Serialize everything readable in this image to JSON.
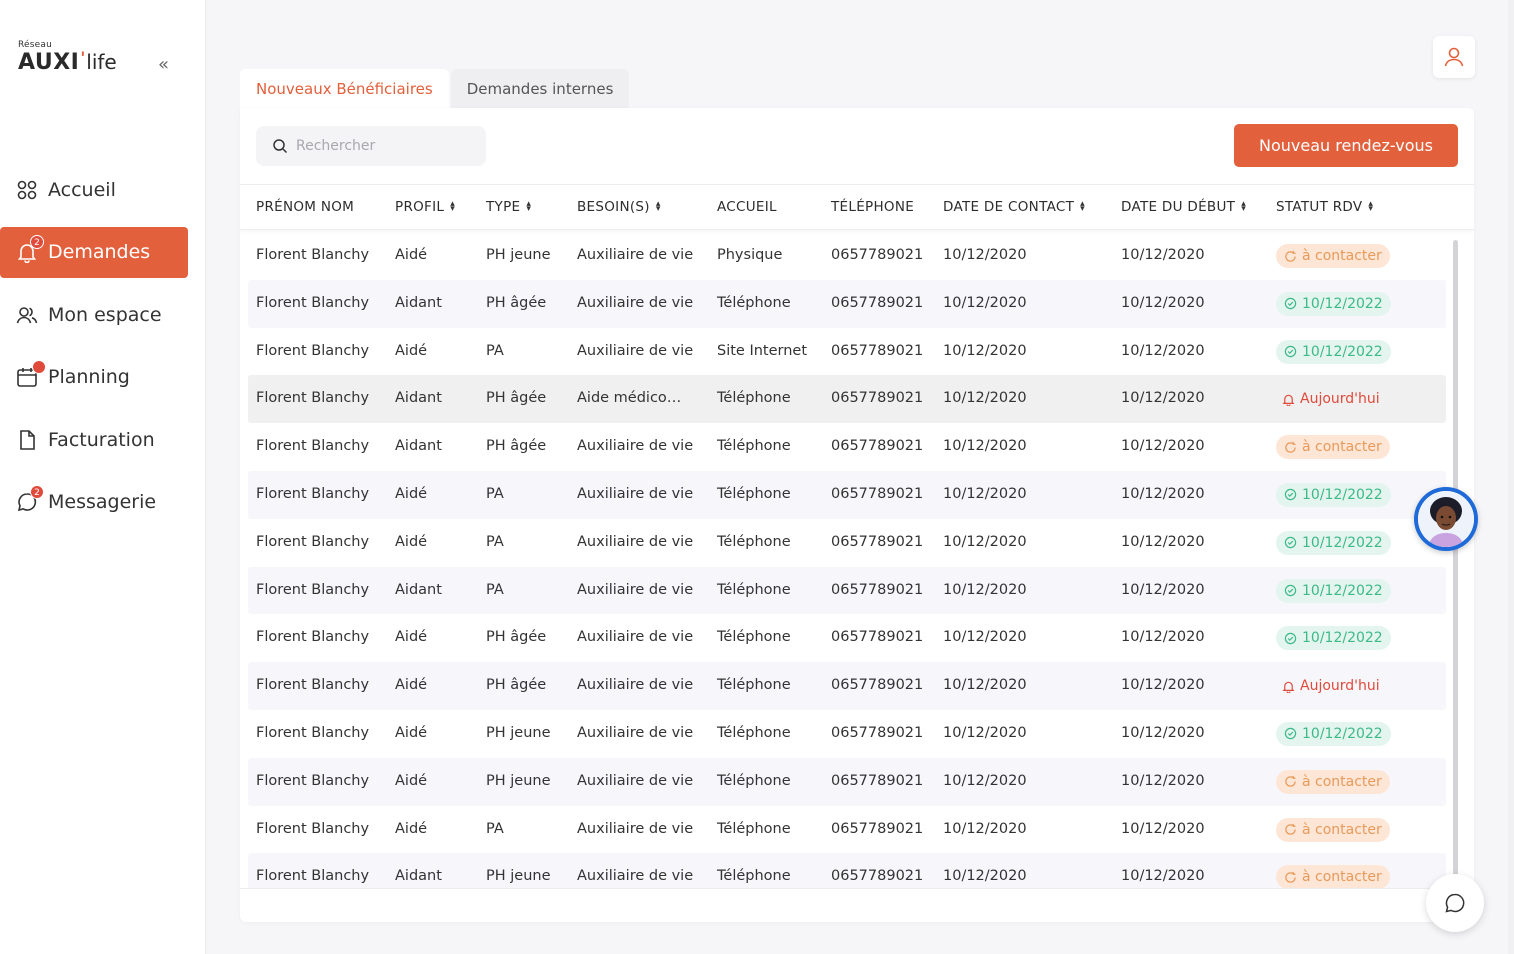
{
  "brand": {
    "small": "Réseau",
    "main": "AUXI",
    "tick": "'",
    "suffix": "life"
  },
  "colors": {
    "accent": "#e2603c",
    "contact": "#e89a5a",
    "date": "#3eb98a",
    "today": "#e04a3a"
  },
  "sidebar": {
    "items": [
      {
        "label": "Accueil",
        "icon": "grid-icon",
        "badge": ""
      },
      {
        "label": "Demandes",
        "icon": "bell-icon",
        "badge": "2",
        "active": true
      },
      {
        "label": "Mon espace",
        "icon": "users-icon",
        "badge": ""
      },
      {
        "label": "Planning",
        "icon": "calendar-icon",
        "badge": "dot"
      },
      {
        "label": "Facturation",
        "icon": "file-icon",
        "badge": ""
      },
      {
        "label": "Messagerie",
        "icon": "chat-icon",
        "badge": "2"
      }
    ]
  },
  "tabs": [
    {
      "label": "Nouveaux Bénéficiaires",
      "active": true
    },
    {
      "label": "Demandes internes",
      "active": false
    }
  ],
  "search": {
    "placeholder": "Rechercher",
    "value": ""
  },
  "new_button": {
    "label": "Nouveau rendez-vous"
  },
  "table": {
    "columns": [
      {
        "label": "PRÉNOM NOM",
        "sortable": false
      },
      {
        "label": "PROFIL",
        "sortable": true
      },
      {
        "label": "TYPE",
        "sortable": true
      },
      {
        "label": "BESOIN(S)",
        "sortable": true
      },
      {
        "label": "ACCUEIL",
        "sortable": false
      },
      {
        "label": "TÉLÉPHONE",
        "sortable": false
      },
      {
        "label": "DATE DE CONTACT",
        "sortable": true
      },
      {
        "label": "DATE DU DÉBUT",
        "sortable": true
      },
      {
        "label": "STATUT RDV",
        "sortable": true
      }
    ],
    "rows": [
      {
        "name": "Florent Blanchy",
        "profil": "Aidé",
        "type": "PH jeune",
        "besoin": "Auxiliaire de vie",
        "accueil": "Physique",
        "tel": "0657789021",
        "contact": "10/12/2020",
        "debut": "10/12/2020",
        "status": "à contacter",
        "kind": "contact"
      },
      {
        "name": "Florent Blanchy",
        "profil": "Aidant",
        "type": "PH âgée",
        "besoin": "Auxiliaire de vie",
        "accueil": "Téléphone",
        "tel": "0657789021",
        "contact": "10/12/2020",
        "debut": "10/12/2020",
        "status": "10/12/2022",
        "kind": "date"
      },
      {
        "name": "Florent Blanchy",
        "profil": "Aidé",
        "type": "PA",
        "besoin": "Auxiliaire de vie",
        "accueil": "Site Internet",
        "tel": "0657789021",
        "contact": "10/12/2020",
        "debut": "10/12/2020",
        "status": "10/12/2022",
        "kind": "date"
      },
      {
        "name": "Florent Blanchy",
        "profil": "Aidant",
        "type": "PH âgée",
        "besoin": "Aide médico…",
        "accueil": "Téléphone",
        "tel": "0657789021",
        "contact": "10/12/2020",
        "debut": "10/12/2020",
        "status": "Aujourd'hui",
        "kind": "today"
      },
      {
        "name": "Florent Blanchy",
        "profil": "Aidant",
        "type": "PH âgée",
        "besoin": "Auxiliaire de vie",
        "accueil": "Téléphone",
        "tel": "0657789021",
        "contact": "10/12/2020",
        "debut": "10/12/2020",
        "status": "à contacter",
        "kind": "contact"
      },
      {
        "name": "Florent Blanchy",
        "profil": "Aidé",
        "type": "PA",
        "besoin": "Auxiliaire de vie",
        "accueil": "Téléphone",
        "tel": "0657789021",
        "contact": "10/12/2020",
        "debut": "10/12/2020",
        "status": "10/12/2022",
        "kind": "date"
      },
      {
        "name": "Florent Blanchy",
        "profil": "Aidé",
        "type": "PA",
        "besoin": "Auxiliaire de vie",
        "accueil": "Téléphone",
        "tel": "0657789021",
        "contact": "10/12/2020",
        "debut": "10/12/2020",
        "status": "10/12/2022",
        "kind": "date"
      },
      {
        "name": "Florent Blanchy",
        "profil": "Aidant",
        "type": "PA",
        "besoin": "Auxiliaire de vie",
        "accueil": "Téléphone",
        "tel": "0657789021",
        "contact": "10/12/2020",
        "debut": "10/12/2020",
        "status": "10/12/2022",
        "kind": "date"
      },
      {
        "name": "Florent Blanchy",
        "profil": "Aidé",
        "type": "PH âgée",
        "besoin": "Auxiliaire de vie",
        "accueil": "Téléphone",
        "tel": "0657789021",
        "contact": "10/12/2020",
        "debut": "10/12/2020",
        "status": "10/12/2022",
        "kind": "date"
      },
      {
        "name": "Florent Blanchy",
        "profil": "Aidé",
        "type": "PH âgée",
        "besoin": "Auxiliaire de vie",
        "accueil": "Téléphone",
        "tel": "0657789021",
        "contact": "10/12/2020",
        "debut": "10/12/2020",
        "status": "Aujourd'hui",
        "kind": "today"
      },
      {
        "name": "Florent Blanchy",
        "profil": "Aidé",
        "type": "PH jeune",
        "besoin": "Auxiliaire de vie",
        "accueil": "Téléphone",
        "tel": "0657789021",
        "contact": "10/12/2020",
        "debut": "10/12/2020",
        "status": "10/12/2022",
        "kind": "date"
      },
      {
        "name": "Florent Blanchy",
        "profil": "Aidé",
        "type": "PH jeune",
        "besoin": "Auxiliaire de vie",
        "accueil": "Téléphone",
        "tel": "0657789021",
        "contact": "10/12/2020",
        "debut": "10/12/2020",
        "status": "à contacter",
        "kind": "contact"
      },
      {
        "name": "Florent Blanchy",
        "profil": "Aidé",
        "type": "PA",
        "besoin": "Auxiliaire de vie",
        "accueil": "Téléphone",
        "tel": "0657789021",
        "contact": "10/12/2020",
        "debut": "10/12/2020",
        "status": "à contacter",
        "kind": "contact"
      },
      {
        "name": "Florent Blanchy",
        "profil": "Aidant",
        "type": "PH jeune",
        "besoin": "Auxiliaire de vie",
        "accueil": "Téléphone",
        "tel": "0657789021",
        "contact": "10/12/2020",
        "debut": "10/12/2020",
        "status": "à contacter",
        "kind": "contact"
      }
    ]
  }
}
